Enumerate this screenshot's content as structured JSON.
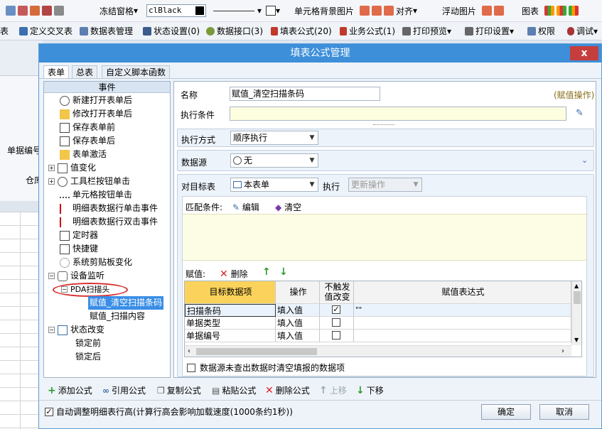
{
  "toolbar1": {
    "freeze": "冻结窗格",
    "color_value": "clBlack",
    "cell_bg": "单元格背景图片",
    "align": "对齐",
    "float_img": "浮动图片",
    "chart": "图表"
  },
  "toolbar2": {
    "items": [
      "表",
      "定义交叉表",
      "数据表管理",
      "状态设置(0)",
      "数据接口(3)",
      "填表公式(20)",
      "业务公式(1)",
      "打印预览",
      "打印设置",
      "权限",
      "调试"
    ]
  },
  "background": {
    "label1": "单据编号",
    "label2": "仓库"
  },
  "dialog": {
    "title": "填表公式管理",
    "close": "x",
    "tabs": [
      "表单",
      "总表",
      "自定义脚本函数"
    ]
  },
  "tree": {
    "header": "事件",
    "nodes": [
      "新建打开表单后",
      "修改打开表单后",
      "保存表单前",
      "保存表单后",
      "表单激活",
      "值变化",
      "工具栏按钮单击",
      "单元格按钮单击",
      "明细表数据行单击事件",
      "明细表数据行双击事件",
      "定时器",
      "快捷键",
      "系统剪贴板变化",
      "设备监听",
      "PDA扫描头",
      "赋值_清空扫描条码",
      "赋值_扫描内容",
      "状态改变",
      "锁定前",
      "锁定后"
    ]
  },
  "form": {
    "name_label": "名称",
    "name_value": "赋值_清空扫描条码",
    "op_type": "(赋值操作)",
    "cond_label": "执行条件",
    "cond_value": "",
    "exec_mode_label": "执行方式",
    "exec_mode_value": "顺序执行",
    "datasource_label": "数据源",
    "datasource_value": "无",
    "target_label": "对目标表",
    "target_value": "本表单",
    "exec_label": "执行",
    "exec_value": "更新操作",
    "match_label": "匹配条件:",
    "edit": "编辑",
    "clear": "清空",
    "assign_label": "赋值:",
    "delete": "删除",
    "grid_headers": [
      "目标数据项",
      "操作",
      "不触发值改变",
      "赋值表达式"
    ],
    "grid_rows": [
      {
        "target": "扫描条码",
        "op": "填入值",
        "checked": true,
        "expr": "\"\""
      },
      {
        "target": "单据类型",
        "op": "填入值",
        "checked": false,
        "expr": ""
      },
      {
        "target": "单据编号",
        "op": "填入值",
        "checked": false,
        "expr": ""
      }
    ],
    "clear_option": "数据源未查出数据时清空填报的数据项"
  },
  "actions": {
    "add": "添加公式",
    "ref": "引用公式",
    "copy": "复制公式",
    "paste": "粘贴公式",
    "del": "删除公式",
    "up": "上移",
    "down": "下移"
  },
  "footer": {
    "auto_adjust": "自动调整明细表行高(计算行高会影响加载速度(1000条约1秒))",
    "ok": "确定",
    "cancel": "取消"
  },
  "colors": {
    "title_bar": "#3d8fd9",
    "close_red": "#c63d3d",
    "header_yellow": "#fbd35c",
    "match_area": "#fdfde6"
  }
}
